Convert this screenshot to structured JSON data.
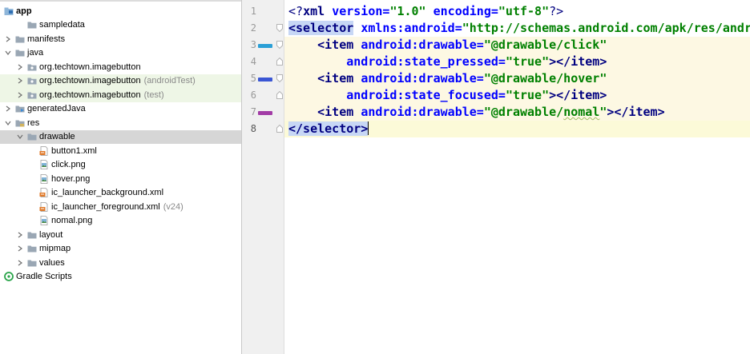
{
  "tree": {
    "items": [
      {
        "id": "app",
        "label": "app",
        "level": 0,
        "arrow": "none",
        "icon": "module-icon",
        "bold": true
      },
      {
        "id": "sampledata",
        "label": "sampledata",
        "level": 1,
        "arrow": "none",
        "icon": "folder-icon"
      },
      {
        "id": "manifests",
        "label": "manifests",
        "level": 0,
        "arrow": "right",
        "icon": "folder-icon"
      },
      {
        "id": "java",
        "label": "java",
        "level": 0,
        "arrow": "down",
        "icon": "folder-icon"
      },
      {
        "id": "pkg-main",
        "label": "org.techtown.imagebutton",
        "level": 1,
        "arrow": "right",
        "icon": "package-icon"
      },
      {
        "id": "pkg-androidtest",
        "label": "org.techtown.imagebutton",
        "suffix": "(androidTest)",
        "level": 1,
        "arrow": "right",
        "icon": "package-icon",
        "highlight": "green"
      },
      {
        "id": "pkg-test",
        "label": "org.techtown.imagebutton",
        "suffix": "(test)",
        "level": 1,
        "arrow": "right",
        "icon": "package-icon",
        "highlight": "green"
      },
      {
        "id": "generatedjava",
        "label": "generatedJava",
        "level": 0,
        "arrow": "right",
        "icon": "generated-folder-icon"
      },
      {
        "id": "res",
        "label": "res",
        "level": 0,
        "arrow": "down",
        "icon": "res-folder-icon"
      },
      {
        "id": "drawable",
        "label": "drawable",
        "level": 1,
        "arrow": "down",
        "icon": "folder-icon",
        "selected": true
      },
      {
        "id": "button1",
        "label": "button1.xml",
        "level": 2,
        "arrow": "none",
        "icon": "xml-file-icon"
      },
      {
        "id": "click",
        "label": "click.png",
        "level": 2,
        "arrow": "none",
        "icon": "image-file-icon"
      },
      {
        "id": "hover",
        "label": "hover.png",
        "level": 2,
        "arrow": "none",
        "icon": "image-file-icon"
      },
      {
        "id": "ic-bg",
        "label": "ic_launcher_background.xml",
        "level": 2,
        "arrow": "none",
        "icon": "xml-file-icon"
      },
      {
        "id": "ic-fg",
        "label": "ic_launcher_foreground.xml",
        "suffix": "(v24)",
        "level": 2,
        "arrow": "none",
        "icon": "xml-file-icon"
      },
      {
        "id": "nomal",
        "label": "nomal.png",
        "level": 2,
        "arrow": "none",
        "icon": "image-file-icon"
      },
      {
        "id": "layout",
        "label": "layout",
        "level": 1,
        "arrow": "right",
        "icon": "folder-icon"
      },
      {
        "id": "mipmap",
        "label": "mipmap",
        "level": 1,
        "arrow": "right",
        "icon": "folder-icon"
      },
      {
        "id": "values",
        "label": "values",
        "level": 1,
        "arrow": "right",
        "icon": "folder-icon"
      },
      {
        "id": "gradle",
        "label": "Gradle Scripts",
        "level": 0,
        "arrow": "none",
        "icon": "gradle-icon"
      }
    ]
  },
  "editor": {
    "current_line": 8,
    "lines": [
      {
        "n": "1",
        "marker": null,
        "fold": null,
        "tokens": [
          {
            "t": "<?",
            "c": "pi"
          },
          {
            "t": "xml ",
            "c": "tag"
          },
          {
            "t": "version=",
            "c": "attr"
          },
          {
            "t": "\"1.0\"",
            "c": "str"
          },
          {
            "t": " ",
            "c": ""
          },
          {
            "t": "encoding=",
            "c": "attr"
          },
          {
            "t": "\"utf-8\"",
            "c": "str"
          },
          {
            "t": "?>",
            "c": "pi"
          }
        ]
      },
      {
        "n": "2",
        "marker": null,
        "fold": "open",
        "tokens": [
          {
            "t": "<selector",
            "c": "tag match"
          },
          {
            "t": " ",
            "c": ""
          },
          {
            "t": "xmlns:android=",
            "c": "attr"
          },
          {
            "t": "\"http://schemas.android.com/apk/res/android\"",
            "c": "str"
          },
          {
            "t": ">",
            "c": "tag"
          }
        ]
      },
      {
        "n": "3",
        "marker": "#2a9fd6",
        "fold": "open",
        "tokens": [
          {
            "t": "    ",
            "c": ""
          },
          {
            "t": "<item ",
            "c": "tag"
          },
          {
            "t": "android:drawable=",
            "c": "attr"
          },
          {
            "t": "\"@drawable/click\"",
            "c": "str"
          }
        ]
      },
      {
        "n": "4",
        "marker": null,
        "fold": "close",
        "tokens": [
          {
            "t": "        ",
            "c": ""
          },
          {
            "t": "android:state_pressed=",
            "c": "attr"
          },
          {
            "t": "\"true\"",
            "c": "str"
          },
          {
            "t": "></item>",
            "c": "tag"
          }
        ]
      },
      {
        "n": "5",
        "marker": "#3a56d4",
        "fold": "open",
        "tokens": [
          {
            "t": "    ",
            "c": ""
          },
          {
            "t": "<item ",
            "c": "tag"
          },
          {
            "t": "android:drawable=",
            "c": "attr"
          },
          {
            "t": "\"@drawable/hover\"",
            "c": "str"
          }
        ]
      },
      {
        "n": "6",
        "marker": null,
        "fold": "close",
        "tokens": [
          {
            "t": "        ",
            "c": ""
          },
          {
            "t": "android:state_focused=",
            "c": "attr"
          },
          {
            "t": "\"true\"",
            "c": "str"
          },
          {
            "t": "></item>",
            "c": "tag"
          }
        ]
      },
      {
        "n": "7",
        "marker": "#a23ca6",
        "fold": null,
        "tokens": [
          {
            "t": "    ",
            "c": ""
          },
          {
            "t": "<item ",
            "c": "tag"
          },
          {
            "t": "android:drawable=",
            "c": "attr"
          },
          {
            "t": "\"@drawable/",
            "c": "str"
          },
          {
            "t": "nomal",
            "c": "str wave"
          },
          {
            "t": "\"",
            "c": "str"
          },
          {
            "t": "></item>",
            "c": "tag"
          }
        ]
      },
      {
        "n": "8",
        "marker": null,
        "fold": "close",
        "tokens": [
          {
            "t": "</selector>",
            "c": "tag match"
          }
        ]
      }
    ]
  }
}
